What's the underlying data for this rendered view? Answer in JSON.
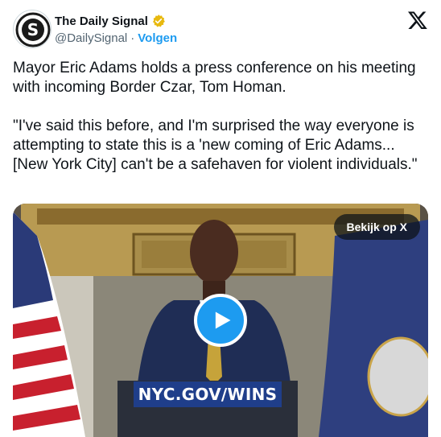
{
  "author": {
    "display_name": "The Daily Signal",
    "handle": "@DailySignal",
    "separator": "·",
    "follow_label": "Volgen",
    "verified_color": "#e8b90f",
    "avatar_icon": "daily-signal-logo"
  },
  "brand": {
    "icon": "x-logo-icon"
  },
  "tweet": {
    "paragraph_1": "Mayor Eric Adams holds a press conference on his meeting with incoming Border Czar, Tom Homan.",
    "paragraph_2": "\"I've said this before, and I'm surprised the way everyone is attempting to state this is a 'new coming of Eric Adams...[New York City] can't be a safehaven for violent individuals.\""
  },
  "media": {
    "view_on_x_label": "Bekijk op X",
    "podium_sign": "NYC.GOV/WINS",
    "play_icon": "play-icon",
    "accent_color": "#1d9bf0"
  }
}
